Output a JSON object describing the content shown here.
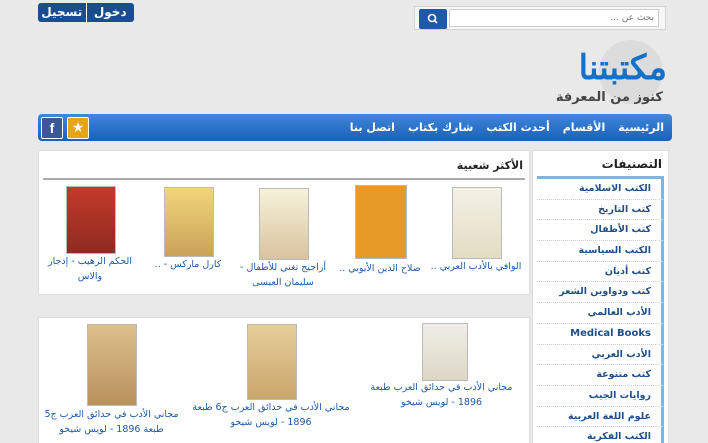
{
  "auth": {
    "register": "تسجيل",
    "login": "دخول"
  },
  "search": {
    "placeholder": "بحث عن ..."
  },
  "logo": {
    "name": "مكتبتنا",
    "tagline": "كنوز من المعرفة"
  },
  "nav": {
    "items": [
      "الرئيسية",
      "الأقسام",
      "أحدث الكتب",
      "شارك بكتاب",
      "اتصل بنا"
    ]
  },
  "sidebar": {
    "title": "التصنيفات",
    "items": [
      "الكتب الاسلامية",
      "كتب التاريخ",
      "كتب الأطفال",
      "الكتب السياسية",
      "كتب أديان",
      "كتب ودواوين الشعر",
      "الأدب العالمي",
      "Medical Books",
      "الأدب العربي",
      "كتب متنوعة",
      "روايات الجيب",
      "علوم اللغة العربية",
      "الكتب الفكرية"
    ]
  },
  "popular": {
    "title": "الأكثر شعبية",
    "books": [
      "الوافي بالأدب العربي ..",
      "صلاح الدين الأيوبي ..",
      "أراجيج تغني للأطفال - سليمان العيسى",
      "كارل ماركس - ..",
      "الحكم الرهيب - إدجار والاس"
    ]
  },
  "latest": {
    "books": [
      "مجاني الأدب في حدائق العرب طبعة 1896 - لويس شيخو",
      "مجاني الأدب في حدائق العرب ج6 طبعة 1896 - لويس شيخو",
      "مجاني الأدب في حدائق العرب ج5 طبعة 1896 - لويس شيخو"
    ]
  },
  "colors": {
    "accent": "#1c5fb8",
    "link": "#1e5aa8",
    "auth": "#1a4d8f"
  }
}
